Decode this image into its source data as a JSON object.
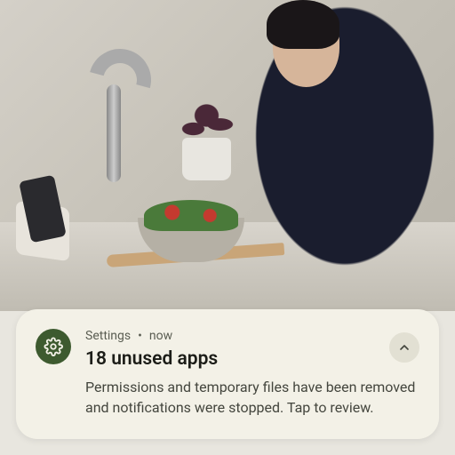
{
  "notification": {
    "app_name": "Settings",
    "timestamp": "now",
    "title": "18 unused apps",
    "body": "Permissions and temporary files have been removed and notifications were stopped. Tap to review.",
    "icon_name": "gear-icon",
    "accent_color": "#3d5a2f"
  }
}
